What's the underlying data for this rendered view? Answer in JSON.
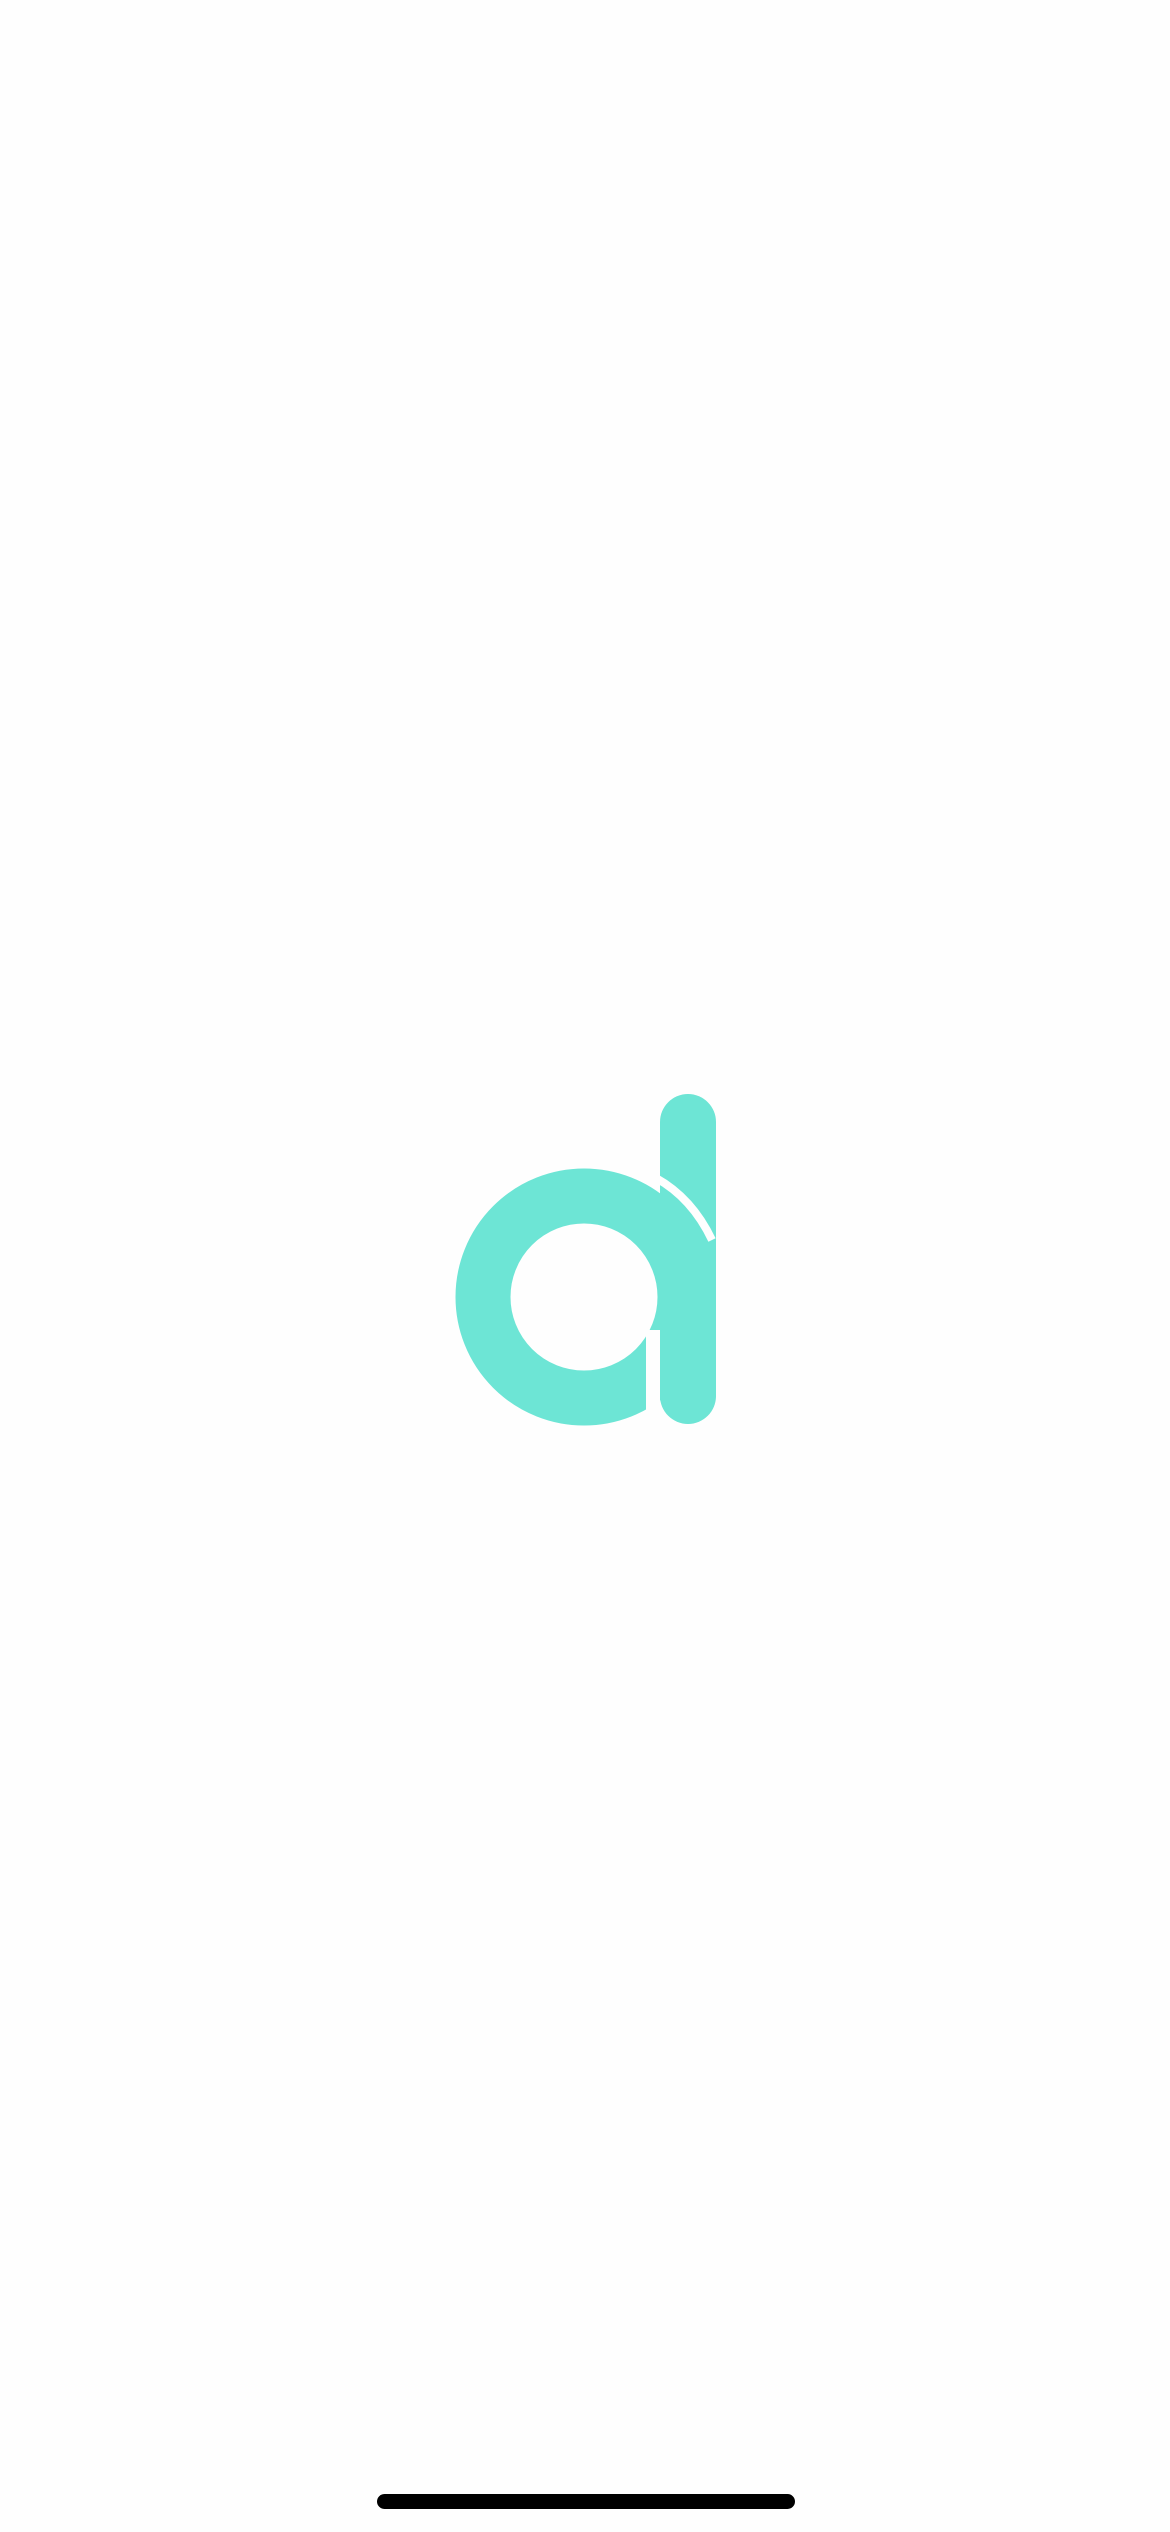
{
  "splash": {
    "logo": {
      "icon": "letter-d-logo-icon",
      "color": "#6de5d5"
    }
  },
  "system": {
    "home_indicator": {
      "color": "#000000"
    }
  }
}
